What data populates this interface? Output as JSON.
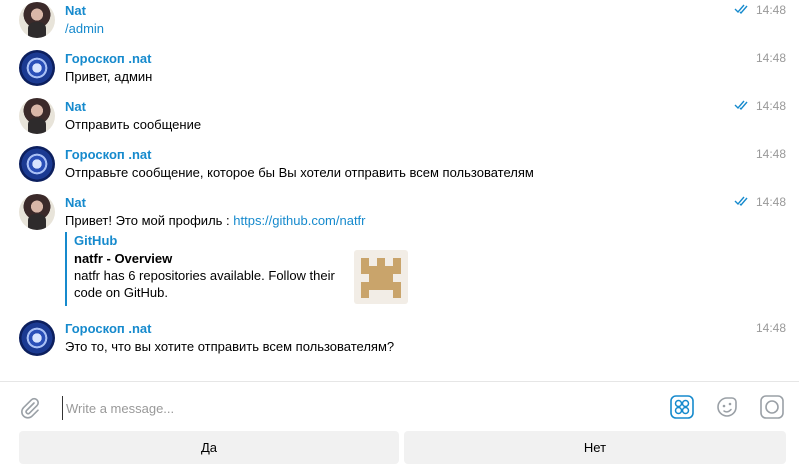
{
  "messages": [
    {
      "sender": "Nat",
      "time": "14:48",
      "text": "/admin",
      "type": "user"
    },
    {
      "sender": "Гороскоп .nat",
      "time": "14:48",
      "text": "Привет, админ",
      "type": "bot"
    },
    {
      "sender": "Nat",
      "time": "14:48",
      "text": "Отправить сообщение",
      "type": "user"
    },
    {
      "sender": "Гороскоп .nat",
      "time": "14:48",
      "text": "Отправьте сообщение, которое бы Вы хотели отправить всем пользователям",
      "type": "bot"
    },
    {
      "sender": "Nat",
      "time": "14:48",
      "text_prefix": "Привет! Это мой профиль : ",
      "link": "https://github.com/natfr",
      "type": "user",
      "preview": {
        "site": "GitHub",
        "title": "natfr - Overview",
        "description": "natfr has 6 repositories available. Follow their code on GitHub."
      }
    },
    {
      "sender": "Гороскоп .nat",
      "time": "14:48",
      "text": "Это то, что вы хотите отправить всем пользователям?",
      "type": "bot"
    }
  ],
  "composer": {
    "placeholder": "Write a message..."
  },
  "keyboard": {
    "yes": "Да",
    "no": "Нет"
  },
  "colors": {
    "accent": "#168acd",
    "time": "#999999",
    "button_bg": "#f1f1f1"
  },
  "icons": [
    "attach-icon",
    "bot-commands-icon",
    "emoji-icon",
    "record-icon",
    "double-check-icon"
  ]
}
